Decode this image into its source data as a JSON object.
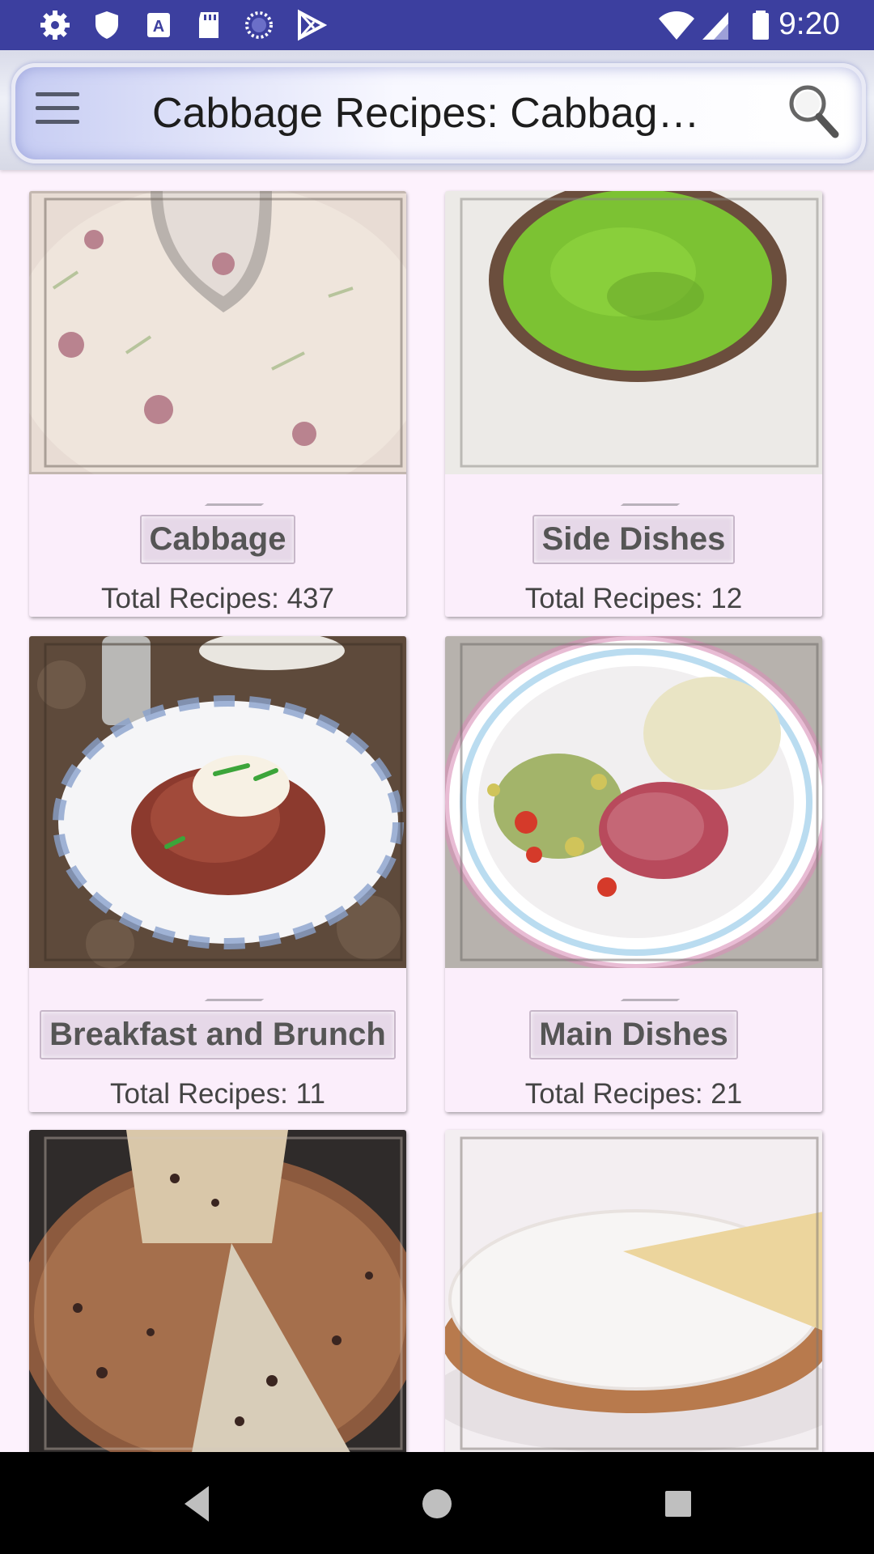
{
  "status_bar": {
    "time": "9:20",
    "left_icons": [
      "gear-icon",
      "shield-icon",
      "a-icon",
      "sd-card-icon",
      "spinner-icon",
      "play-store-icon"
    ],
    "right_icons": [
      "wifi-icon",
      "signal-icon",
      "battery-icon"
    ]
  },
  "app_bar": {
    "title": "Cabbage Recipes: Cabbage…",
    "menu_icon": "hamburger-menu-icon",
    "search_icon": "search-icon"
  },
  "categories": [
    {
      "title": "Cabbage",
      "count": "Total Recipes: 437"
    },
    {
      "title": "Side Dishes",
      "count": "Total Recipes: 12"
    },
    {
      "title": "Breakfast and Brunch",
      "count": "Total Recipes: 11"
    },
    {
      "title": "Main Dishes",
      "count": "Total Recipes: 21"
    },
    {
      "title": "",
      "count": ""
    },
    {
      "title": "",
      "count": ""
    }
  ],
  "nav_bar": {
    "back_icon": "back-triangle-icon",
    "home_icon": "home-circle-icon",
    "recents_icon": "recents-square-icon"
  },
  "colors": {
    "status_bar": "#3c3f9f",
    "background": "#fdf2fd",
    "card": "#fbeefb",
    "badge": "#e6d8e8"
  }
}
